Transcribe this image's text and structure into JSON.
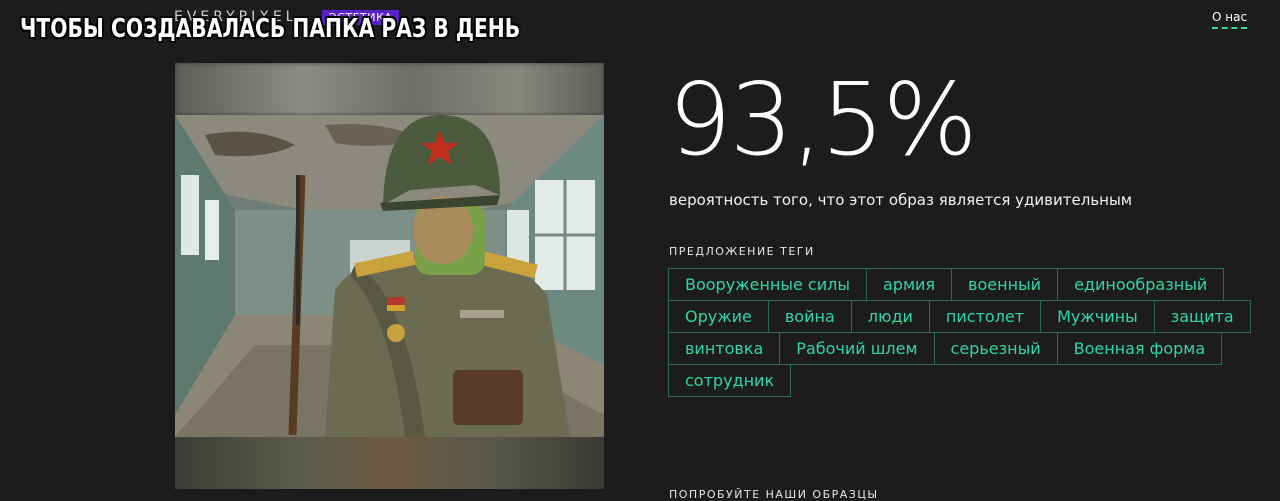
{
  "header": {
    "logo": "EVERYPIXEL",
    "badge": "ЭСТЕТИКА",
    "about_link": "О нас"
  },
  "overlay_title": "ЧТОБЫ СОЗДАВАЛАСЬ ПАПКА РАЗ В ДЕНЬ",
  "result": {
    "percent": "93,5%",
    "description": "вероятность того, что этот образ является удивительным"
  },
  "tags_section": {
    "label": "ПРЕДЛОЖЕНИЕ ТЕГИ",
    "rows": [
      [
        "Вооруженные силы",
        "армия",
        "военный",
        "единообразный"
      ],
      [
        "Оружие",
        "война",
        "люди",
        "пистолет",
        "Мужчины",
        "защита"
      ],
      [
        "винтовка",
        "Рабочий шлем",
        "серьезный",
        "Военная форма"
      ],
      [
        "сотрудник"
      ]
    ]
  },
  "samples_section": {
    "label": "ПОПРОБУЙТЕ НАШИ ОБРАЗЦЫ"
  },
  "colors": {
    "background": "#1c1c1c",
    "accent": "#2fd6a7",
    "badge": "#5b22c9"
  }
}
